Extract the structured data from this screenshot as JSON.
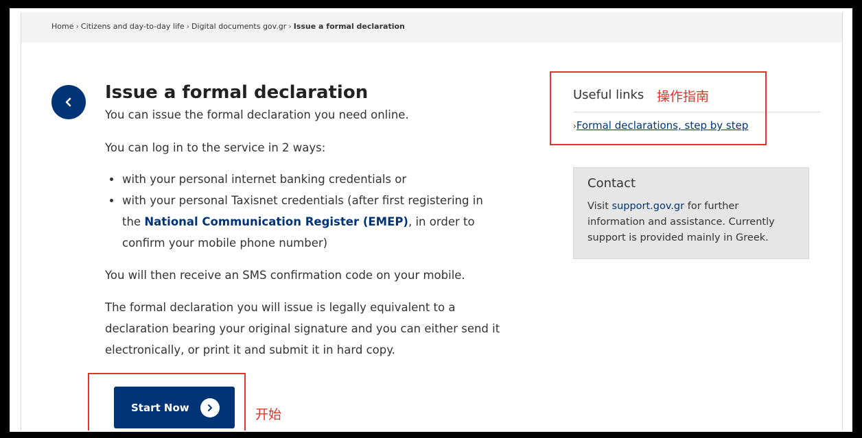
{
  "breadcrumb": {
    "items": [
      "Home",
      "Citizens and day-to-day life",
      "Digital documents gov.gr"
    ],
    "current": "Issue a formal declaration",
    "separator": "›"
  },
  "main": {
    "title": "Issue a formal declaration",
    "intro": "You can issue the formal declaration you need online.",
    "login_intro": "You can log in to the service in 2 ways:",
    "way1": "with your personal internet banking credentials or",
    "way2_before": "with your personal Taxisnet credentials (after first registering in the ",
    "way2_link": "National Communication Register (EMEP)",
    "way2_after": ", in order to confirm your mobile phone number)",
    "sms": "You will then receive an SMS confirmation code on your mobile.",
    "legal": "The formal declaration you will issue is legally equivalent to a declaration bearing your original signature and you can either send it electronically, or print it and submit it in hard copy.",
    "start_label": "Start Now"
  },
  "sidebar": {
    "useful_title": "Useful links",
    "useful_link": "Formal declarations, step by step",
    "contact_title": "Contact",
    "contact_before": "Visit ",
    "contact_link": "support.gov.gr",
    "contact_after": " for further information and assistance. Currently support is provided mainly in Greek."
  },
  "annotations": {
    "guide": "操作指南",
    "start": "开始"
  },
  "colors": {
    "brand": "#003476",
    "annotation": "#e0352b"
  },
  "icons": {
    "back": "chevron-left-icon",
    "start": "chevron-right-icon"
  }
}
